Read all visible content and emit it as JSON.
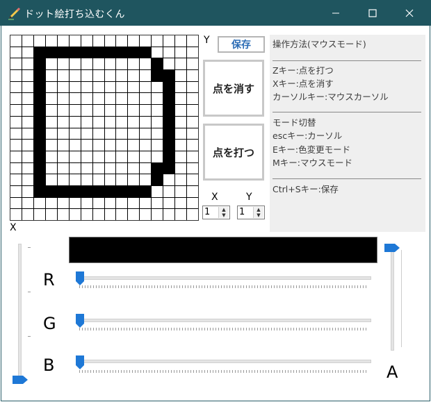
{
  "window": {
    "title": "ドット絵打ち込むくん",
    "icon": "pencil-icon",
    "controls": [
      "minimize-icon",
      "maximize-icon",
      "close-icon"
    ]
  },
  "canvas": {
    "size": 16,
    "rows": [
      "................",
      "..##########....",
      "..#.........#...",
      "..#.........##..",
      "..#..........#..",
      "..#..........#..",
      "..#..........#..",
      "..#..........#..",
      "..#..........#..",
      "..#..........#..",
      "..#..........#..",
      "..#.........##..",
      "..#.........#...",
      "..##########....",
      "................",
      "................"
    ],
    "x_axis_label": "X",
    "y_axis_label": "Y"
  },
  "buttons": {
    "save": "保存",
    "erase": "点を消す",
    "draw": "点を打つ"
  },
  "cursor": {
    "x_label": "X",
    "y_label": "Y",
    "x_value": "1",
    "y_value": "1"
  },
  "help": {
    "mode_title": "操作方法(マウスモード)",
    "z_key": "Zキー:点を打つ",
    "x_key": "Xキー:点を消す",
    "cursor_key": "カーソルキー:マウスカーソル",
    "switch_title": "モード切替",
    "esc_key": "escキー:カーソル",
    "e_key": "Eキー:色変更モード",
    "m_key": "Mキー:マウスモード",
    "save_key": "Ctrl+Sキー:保存"
  },
  "color": {
    "preview": "#000000",
    "r_label": "R",
    "g_label": "G",
    "b_label": "B",
    "a_label": "A",
    "r_value": 0,
    "g_value": 0,
    "b_value": 0,
    "a_value": 255,
    "accent": "#1e78d6"
  }
}
